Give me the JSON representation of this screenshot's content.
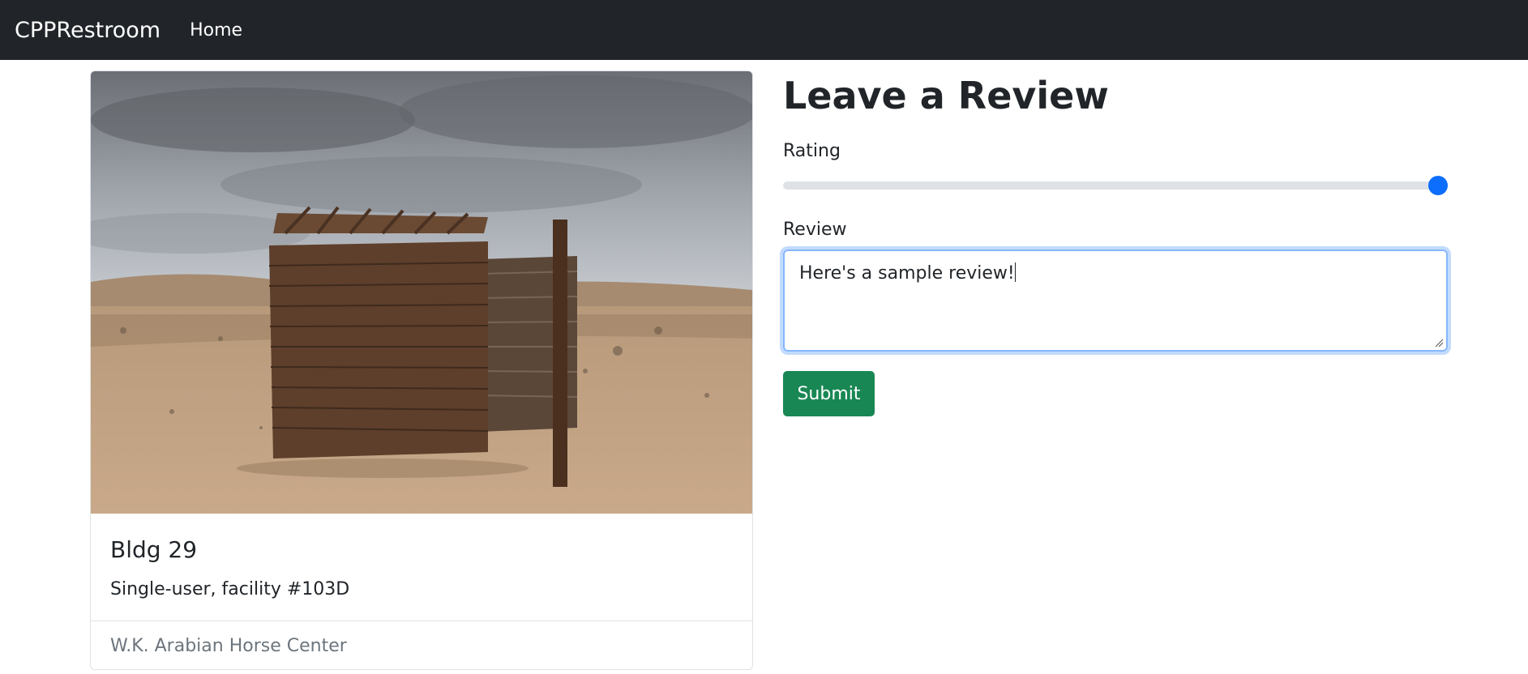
{
  "navbar": {
    "brand": "CPPRestroom",
    "home_link": "Home"
  },
  "card": {
    "image_alt": "Wooden outhouse in the desert",
    "title": "Bldg 29",
    "text": "Single-user, facility #103D",
    "footer": "W.K. Arabian Horse Center"
  },
  "review_form": {
    "heading": "Leave a Review",
    "rating_label": "Rating",
    "rating_value_fraction": 1.0,
    "review_label": "Review",
    "review_text": "Here's a sample review!",
    "submit_label": "Submit"
  },
  "colors": {
    "navbar_bg": "#212529",
    "accent_blue": "#0d6efd",
    "submit_green": "#198754",
    "muted_text": "#6c757d"
  }
}
